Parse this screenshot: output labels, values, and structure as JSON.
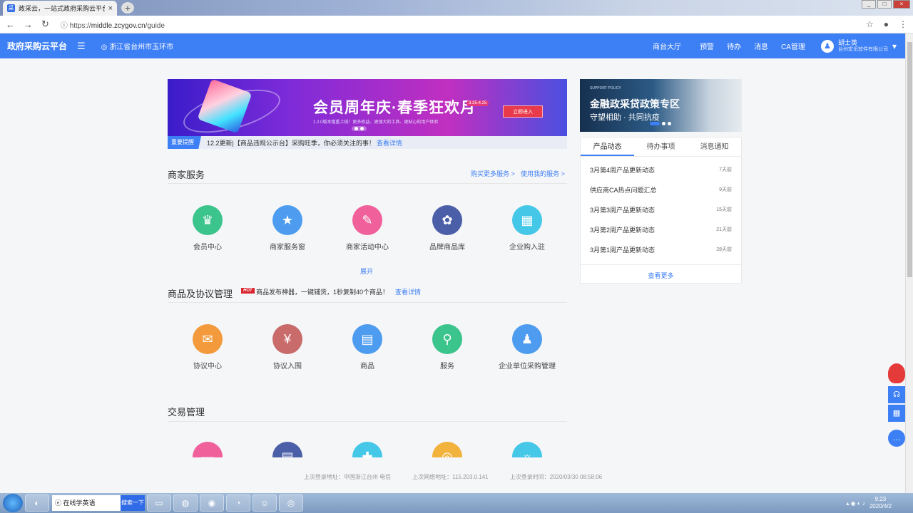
{
  "browser": {
    "tab_title": "政采云，一站式政府采购云平台",
    "tab_close": "×",
    "new_tab": "+",
    "url_prefix": "https://",
    "url_host": "middle.zcygov.cn",
    "url_path": "/guide",
    "back": "←",
    "forward": "→",
    "reload": "↻",
    "secure_icon": "ⓘ",
    "star": "☆",
    "profile": "●",
    "menu": "⋮"
  },
  "header": {
    "logo": "政府采购云平台",
    "menu_icon": "☰",
    "location": "浙江省台州市玉环市",
    "links": [
      "商台大厅",
      "预警",
      "待办",
      "消息",
      "CA管理"
    ],
    "user_name": "胡士英",
    "user_company": "台州宏讯软件有限公司"
  },
  "banner": {
    "title": "会员周年庆·春季狂欢月",
    "date": "3.25-4.25",
    "sub": "1.2.0版本隆重上线！更多权益、更强大的工具、更贴心的用户体验",
    "cta": "立即进入"
  },
  "notice": {
    "tag": "重要提醒",
    "text": "12.2更新|【商品违规公示台】采购旺季，你必须关注的事！",
    "link": "查看详情"
  },
  "merchant": {
    "title": "商家服务",
    "link1": "购买更多服务 >",
    "link2": "使用我的服务 >",
    "expand": "展开",
    "items": [
      {
        "label": "会员中心",
        "icon": "♛",
        "color": "#3bc48c"
      },
      {
        "label": "商家服务窗",
        "icon": "★",
        "color": "#4e9cf0"
      },
      {
        "label": "商家活动中心",
        "icon": "✎",
        "color": "#f0619c"
      },
      {
        "label": "品牌商品库",
        "icon": "✿",
        "color": "#4b5fa8"
      },
      {
        "label": "企业购入驻",
        "icon": "▦",
        "color": "#45c8e8"
      }
    ]
  },
  "goods": {
    "title": "商品及协议管理",
    "hot": "HOT",
    "promo": "商品发布神器，一键铺货，1秒复制40个商品！",
    "promo_link": "查看详情",
    "items": [
      {
        "label": "协议中心",
        "icon": "✉",
        "color": "#f29a3c"
      },
      {
        "label": "协议入围",
        "icon": "¥",
        "color": "#c96b6b"
      },
      {
        "label": "商品",
        "icon": "▤",
        "color": "#4e9cf0"
      },
      {
        "label": "服务",
        "icon": "⚲",
        "color": "#3bc48c"
      },
      {
        "label": "企业单位采购管理",
        "icon": "♟",
        "color": "#4e9cf0"
      }
    ]
  },
  "trade": {
    "title": "交易管理",
    "items": [
      {
        "icon": "▬",
        "color": "#f0619c"
      },
      {
        "icon": "▤",
        "color": "#4b5fa8"
      },
      {
        "icon": "✚",
        "color": "#45c8e8"
      },
      {
        "icon": "◎",
        "color": "#f2b33c"
      },
      {
        "icon": "☼",
        "color": "#45c8e8"
      }
    ]
  },
  "policy": {
    "small": "SUPPORT POLICY",
    "title": "金融政采贷政策专区",
    "sub": "守望相助 · 共同抗疫"
  },
  "news": {
    "tabs": [
      "产品动态",
      "待办事项",
      "消息通知"
    ],
    "rows": [
      {
        "name": "3月第4周产品更新动态",
        "date": "7天前"
      },
      {
        "name": "供应商CA热点问题汇总",
        "date": "9天前"
      },
      {
        "name": "3月第3周产品更新动态",
        "date": "15天前"
      },
      {
        "name": "3月第2周产品更新动态",
        "date": "21天前"
      },
      {
        "name": "3月第1周产品更新动态",
        "date": "28天前"
      }
    ],
    "more": "查看更多"
  },
  "footer": {
    "login_location": "上次登录地址：中国浙江台州 电信",
    "network": "上次网络地址：115.203.0.141",
    "login_time": "上次登录时间：2020/03/30 08:58:06"
  },
  "taskbar": {
    "search_text": "在线学英语",
    "search_btn": "搜索一下",
    "time": "9:23",
    "date": "2020/4/2"
  },
  "accent": "#3d7ff5"
}
